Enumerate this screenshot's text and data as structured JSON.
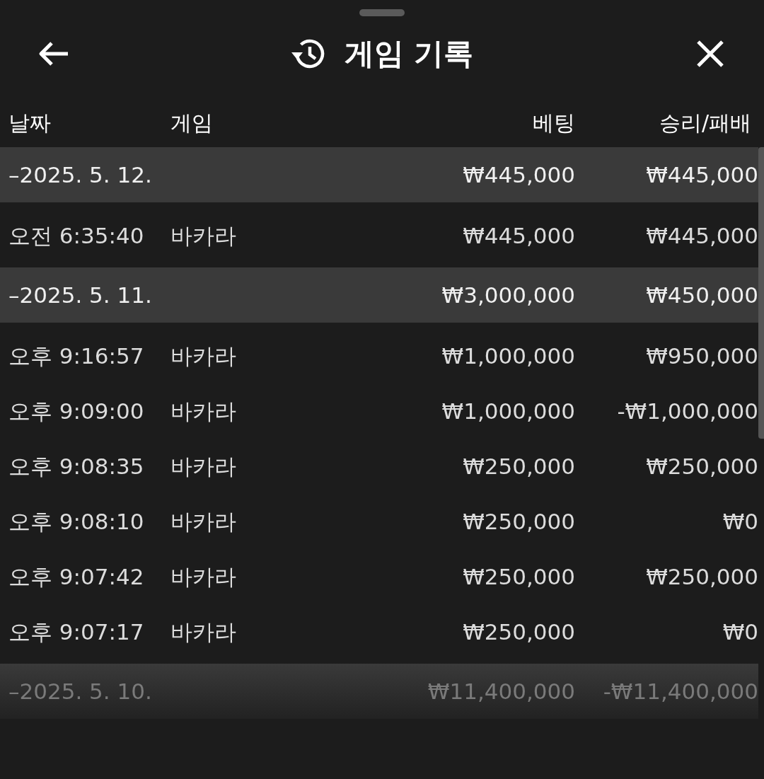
{
  "header": {
    "title": "게임 기록"
  },
  "columns": [
    "날짜",
    "게임",
    "베팅",
    "승리/패배"
  ],
  "groups": [
    {
      "date": "–2025. 5. 12.",
      "bet": "₩445,000",
      "result": "₩445,000",
      "rows": [
        {
          "time": "오전 6:35:40",
          "game": "바카라",
          "bet": "₩445,000",
          "result": "₩445,000"
        }
      ]
    },
    {
      "date": "–2025. 5. 11.",
      "bet": "₩3,000,000",
      "result": "₩450,000",
      "rows": [
        {
          "time": "오후 9:16:57",
          "game": "바카라",
          "bet": "₩1,000,000",
          "result": "₩950,000"
        },
        {
          "time": "오후 9:09:00",
          "game": "바카라",
          "bet": "₩1,000,000",
          "result": "-₩1,000,000"
        },
        {
          "time": "오후 9:08:35",
          "game": "바카라",
          "bet": "₩250,000",
          "result": "₩250,000"
        },
        {
          "time": "오후 9:08:10",
          "game": "바카라",
          "bet": "₩250,000",
          "result": "₩0"
        },
        {
          "time": "오후 9:07:42",
          "game": "바카라",
          "bet": "₩250,000",
          "result": "₩250,000"
        },
        {
          "time": "오후 9:07:17",
          "game": "바카라",
          "bet": "₩250,000",
          "result": "₩0"
        }
      ]
    },
    {
      "date": "–2025. 5. 10.",
      "bet": "₩11,400,000",
      "result": "-₩11,400,000"
    }
  ]
}
